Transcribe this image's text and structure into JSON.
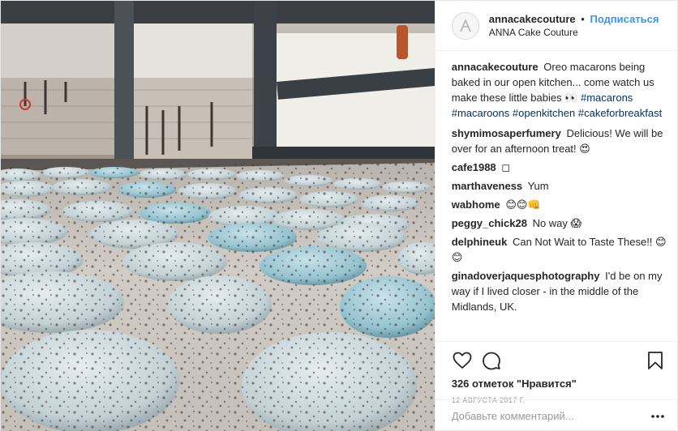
{
  "header": {
    "username": "annacakecouture",
    "dot": "•",
    "follow_label": "Подписаться",
    "subtitle": "ANNA Cake Couture"
  },
  "caption": {
    "user": "annacakecouture",
    "text": "Oreo macarons being baked in our open kitchen... come watch us make these little babies 👀",
    "hashtags": [
      "#macarons",
      "#macaroons",
      "#openkitchen",
      "#cakeforbreakfast"
    ]
  },
  "comments": [
    {
      "user": "shymimosaperfumery",
      "text": "Delicious! We will be over for an afternoon treat! 😍"
    },
    {
      "user": "cafe1988",
      "text": "◻"
    },
    {
      "user": "marthaveness",
      "text": "Yum"
    },
    {
      "user": "wabhome",
      "text": "😊😊👊"
    },
    {
      "user": "peggy_chick28",
      "text": "No way 😱"
    },
    {
      "user": "delphineuk",
      "text": "Can Not Wait to Taste These!! 😊😊"
    },
    {
      "user": "ginadoverjaquesphotography",
      "text": "I'd be on my way if I lived closer - in the middle of the Midlands, UK."
    }
  ],
  "footer": {
    "likes": "326 отметок \"Нравится\"",
    "date": "12 августа 2017 г.",
    "comment_placeholder": "Добавьте комментарий..."
  },
  "icons": {
    "avatar": "avatar-placeholder-icon",
    "like": "heart-icon",
    "comment": "speech-bubble-icon",
    "save": "bookmark-icon",
    "more": "ellipsis-icon"
  },
  "colors": {
    "link": "#3897f0",
    "hashtag": "#003569",
    "muted": "#999999"
  }
}
